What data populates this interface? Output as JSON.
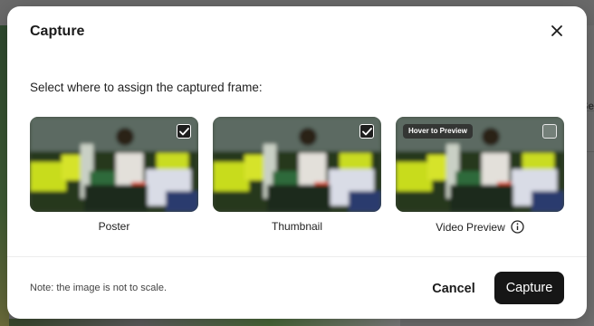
{
  "background_app": {
    "partial_column_label": "Se"
  },
  "modal": {
    "title": "Capture",
    "instruction": "Select where to assign the captured frame:",
    "options": [
      {
        "label": "Poster",
        "checked": true,
        "hover_badge": ""
      },
      {
        "label": "Thumbnail",
        "checked": true,
        "hover_badge": ""
      },
      {
        "label": "Video Preview",
        "checked": false,
        "hover_badge": "Hover to Preview"
      }
    ],
    "note": "Note: the image is not to scale.",
    "cancel_label": "Cancel",
    "capture_label": "Capture"
  },
  "icons": {
    "close": "close-icon",
    "check": "check-icon",
    "info": "info-icon"
  },
  "colors": {
    "primary_button": "#161616",
    "checkbox_checked": "#1e1e1e",
    "text": "#1b1b1b",
    "overlay": "#6a6a6a"
  }
}
